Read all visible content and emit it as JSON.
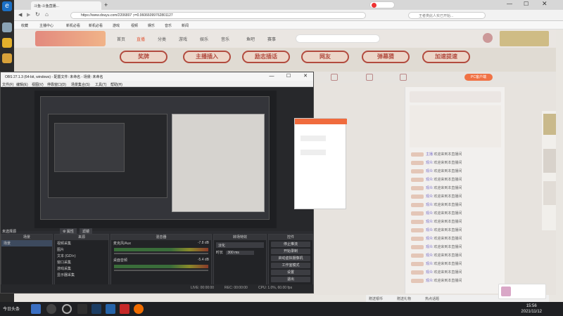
{
  "left_strip": {
    "badge": "e"
  },
  "browser": {
    "tabs": [
      "斗鱼-斗鱼直播..."
    ],
    "url": "https://www.douyu.com/2206807 ;r=0.96066099762801127",
    "search_placeholder": "王者类此人实已开始...",
    "bookmarks": [
      "收藏",
      "主播中心",
      "新机必看",
      "新机必看",
      "游戏",
      "视频",
      "娱乐",
      "音乐",
      "新闻"
    ]
  },
  "site": {
    "nav": [
      "首页",
      "直播",
      "分类",
      "游戏",
      "娱乐",
      "音乐",
      "鱼吧",
      "赛事"
    ],
    "banner_pills": [
      "奖牌",
      "主播插入",
      "励志插话",
      "网友",
      "弹幕猜",
      "加速提速"
    ],
    "pc_badge": "PC客户端"
  },
  "chat": {
    "entries": [
      {
        "level": "lv",
        "name": "主播",
        "text": "欢迎来到本直播间"
      },
      {
        "level": "lv",
        "name": "观众",
        "text": "欢迎来到本直播间"
      },
      {
        "level": "lv",
        "name": "观众",
        "text": "欢迎来到本直播间"
      },
      {
        "level": "lv",
        "name": "观众",
        "text": "欢迎来到本直播间"
      },
      {
        "level": "lv",
        "name": "观众",
        "text": "欢迎来到本直播间"
      },
      {
        "level": "lv",
        "name": "观众",
        "text": "欢迎来到本直播间"
      },
      {
        "level": "lv",
        "name": "观众",
        "text": "欢迎来到本直播间"
      },
      {
        "level": "lv",
        "name": "观众",
        "text": "欢迎来到本直播间"
      },
      {
        "level": "lv",
        "name": "观众",
        "text": "欢迎来到本直播间"
      },
      {
        "level": "lv",
        "name": "观众",
        "text": "欢迎来到本直播间"
      },
      {
        "level": "lv",
        "name": "观众",
        "text": "欢迎来到本直播间"
      },
      {
        "level": "lv",
        "name": "观众",
        "text": "欢迎来到本直播间"
      },
      {
        "level": "lv",
        "name": "观众",
        "text": "欢迎来到本直播间"
      },
      {
        "level": "lv",
        "name": "观众",
        "text": "欢迎来到本直播间"
      },
      {
        "level": "lv",
        "name": "观众",
        "text": "欢迎来到本直播间"
      },
      {
        "level": "lv",
        "name": "观众",
        "text": "欢迎来到本直播间"
      }
    ],
    "footer": [
      "赠送银币",
      "赠送礼物",
      "热点话题"
    ]
  },
  "obs": {
    "title": "OBS 27.1.3 (64-bit, windows) - 配置文件: 未命名 - 场景: 未命名",
    "menu": [
      "文件(F)",
      "编辑(E)",
      "视图(V)",
      "停靠窗口(D)",
      "场景集合(S)",
      "工具(T)",
      "帮助(H)"
    ],
    "no_source": "未选择源",
    "properties_label": "属性",
    "filters_label": "滤镜",
    "docks": {
      "scenes": {
        "title": "场景",
        "items": [
          "场景"
        ]
      },
      "sources": {
        "title": "来源",
        "items": [
          "视频采集",
          "图片",
          "文本 (GDI+)",
          "窗口采集",
          "游戏采集",
          "显示器采集"
        ]
      },
      "mixer": {
        "title": "混音器",
        "tracks": [
          "麦克风/Aux",
          "桌面音频"
        ],
        "levels": [
          "-7.8 dB",
          "-5.4 dB"
        ]
      },
      "transitions": {
        "title": "转场特效",
        "type": "淡化",
        "duration_label": "时长",
        "duration": "300 ms"
      },
      "controls": {
        "title": "控件",
        "buttons": [
          "停止推流",
          "开始录制",
          "启动虚拟摄像机",
          "工作室模式",
          "设置",
          "退出"
        ]
      }
    },
    "status": {
      "live": "LIVE: 00:00:00",
      "rec": "REC: 00:00:00",
      "cpu": "CPU: 1.0%, 60.00 fps"
    }
  },
  "taskbar": {
    "start": "今日头条",
    "time": "15:56",
    "date": "2021/11/12"
  }
}
